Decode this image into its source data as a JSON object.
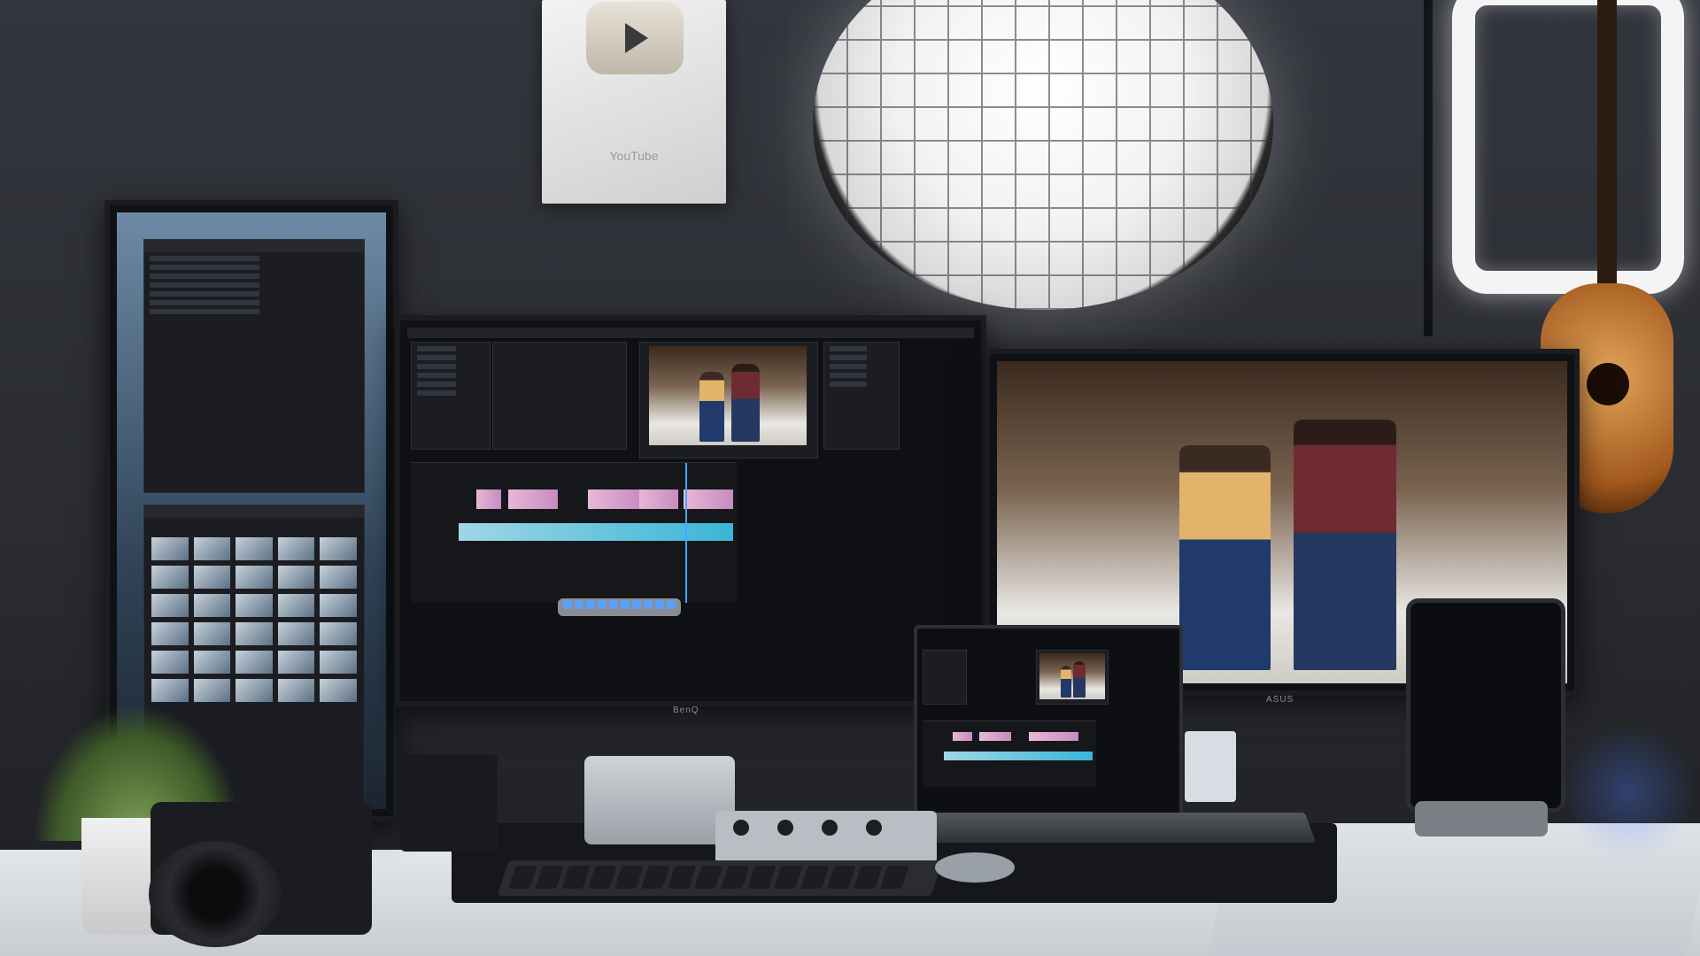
{
  "scene": {
    "plaque_brand": "YouTube",
    "center_monitor_brand": "BenQ",
    "right_monitor_brand": "ASUS"
  },
  "colors": {
    "wall": "#2b2d33",
    "desk": "#e3e6ea",
    "clip_pink": "#e7b8d6",
    "clip_cyan": "#39b6d6",
    "playhead": "#49a6ff"
  },
  "icons": [
    "play-icon"
  ]
}
